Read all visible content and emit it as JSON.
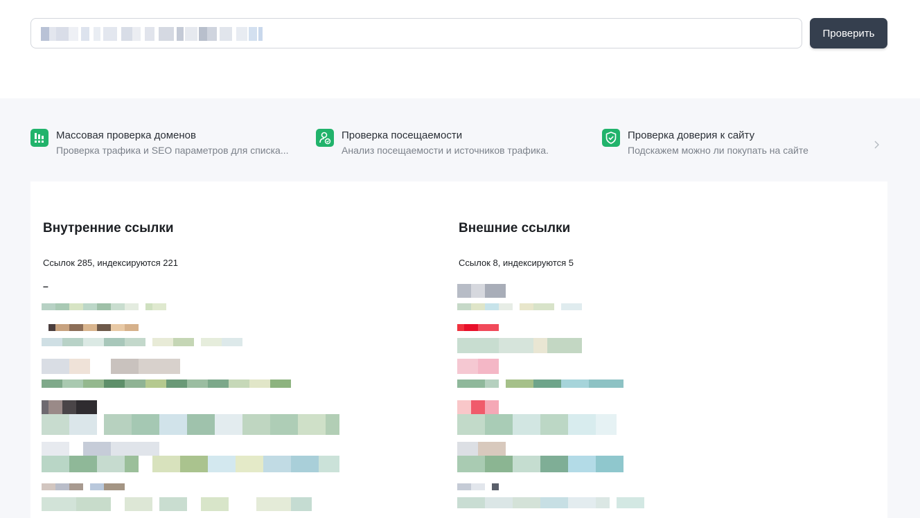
{
  "search": {
    "value": "",
    "placeholder": ""
  },
  "check_button": "Проверить",
  "tools": [
    {
      "title": "Массовая проверка доменов",
      "subtitle": "Проверка трафика и SEO параметров для списка...",
      "icon": "chart-bars-icon"
    },
    {
      "title": "Проверка посещаемости",
      "subtitle": "Анализ посещаемости и источников трафика.",
      "icon": "user-check-icon"
    },
    {
      "title": "Проверка доверия к сайту",
      "subtitle": "Подскажем можно ли покупать на сайте",
      "icon": "shield-check-icon"
    }
  ],
  "next_icon": "chevron-right-icon",
  "internal": {
    "heading": "Внутренние ссылки",
    "stats": "Ссылок 285, индексируются 221",
    "dash": "–"
  },
  "external": {
    "heading": "Внешние ссылки",
    "stats": "Ссылок 8, индексируются 5"
  },
  "colors": {
    "accent": "#21b36b",
    "button": "#353f4e",
    "background": "#f6f7fa"
  }
}
